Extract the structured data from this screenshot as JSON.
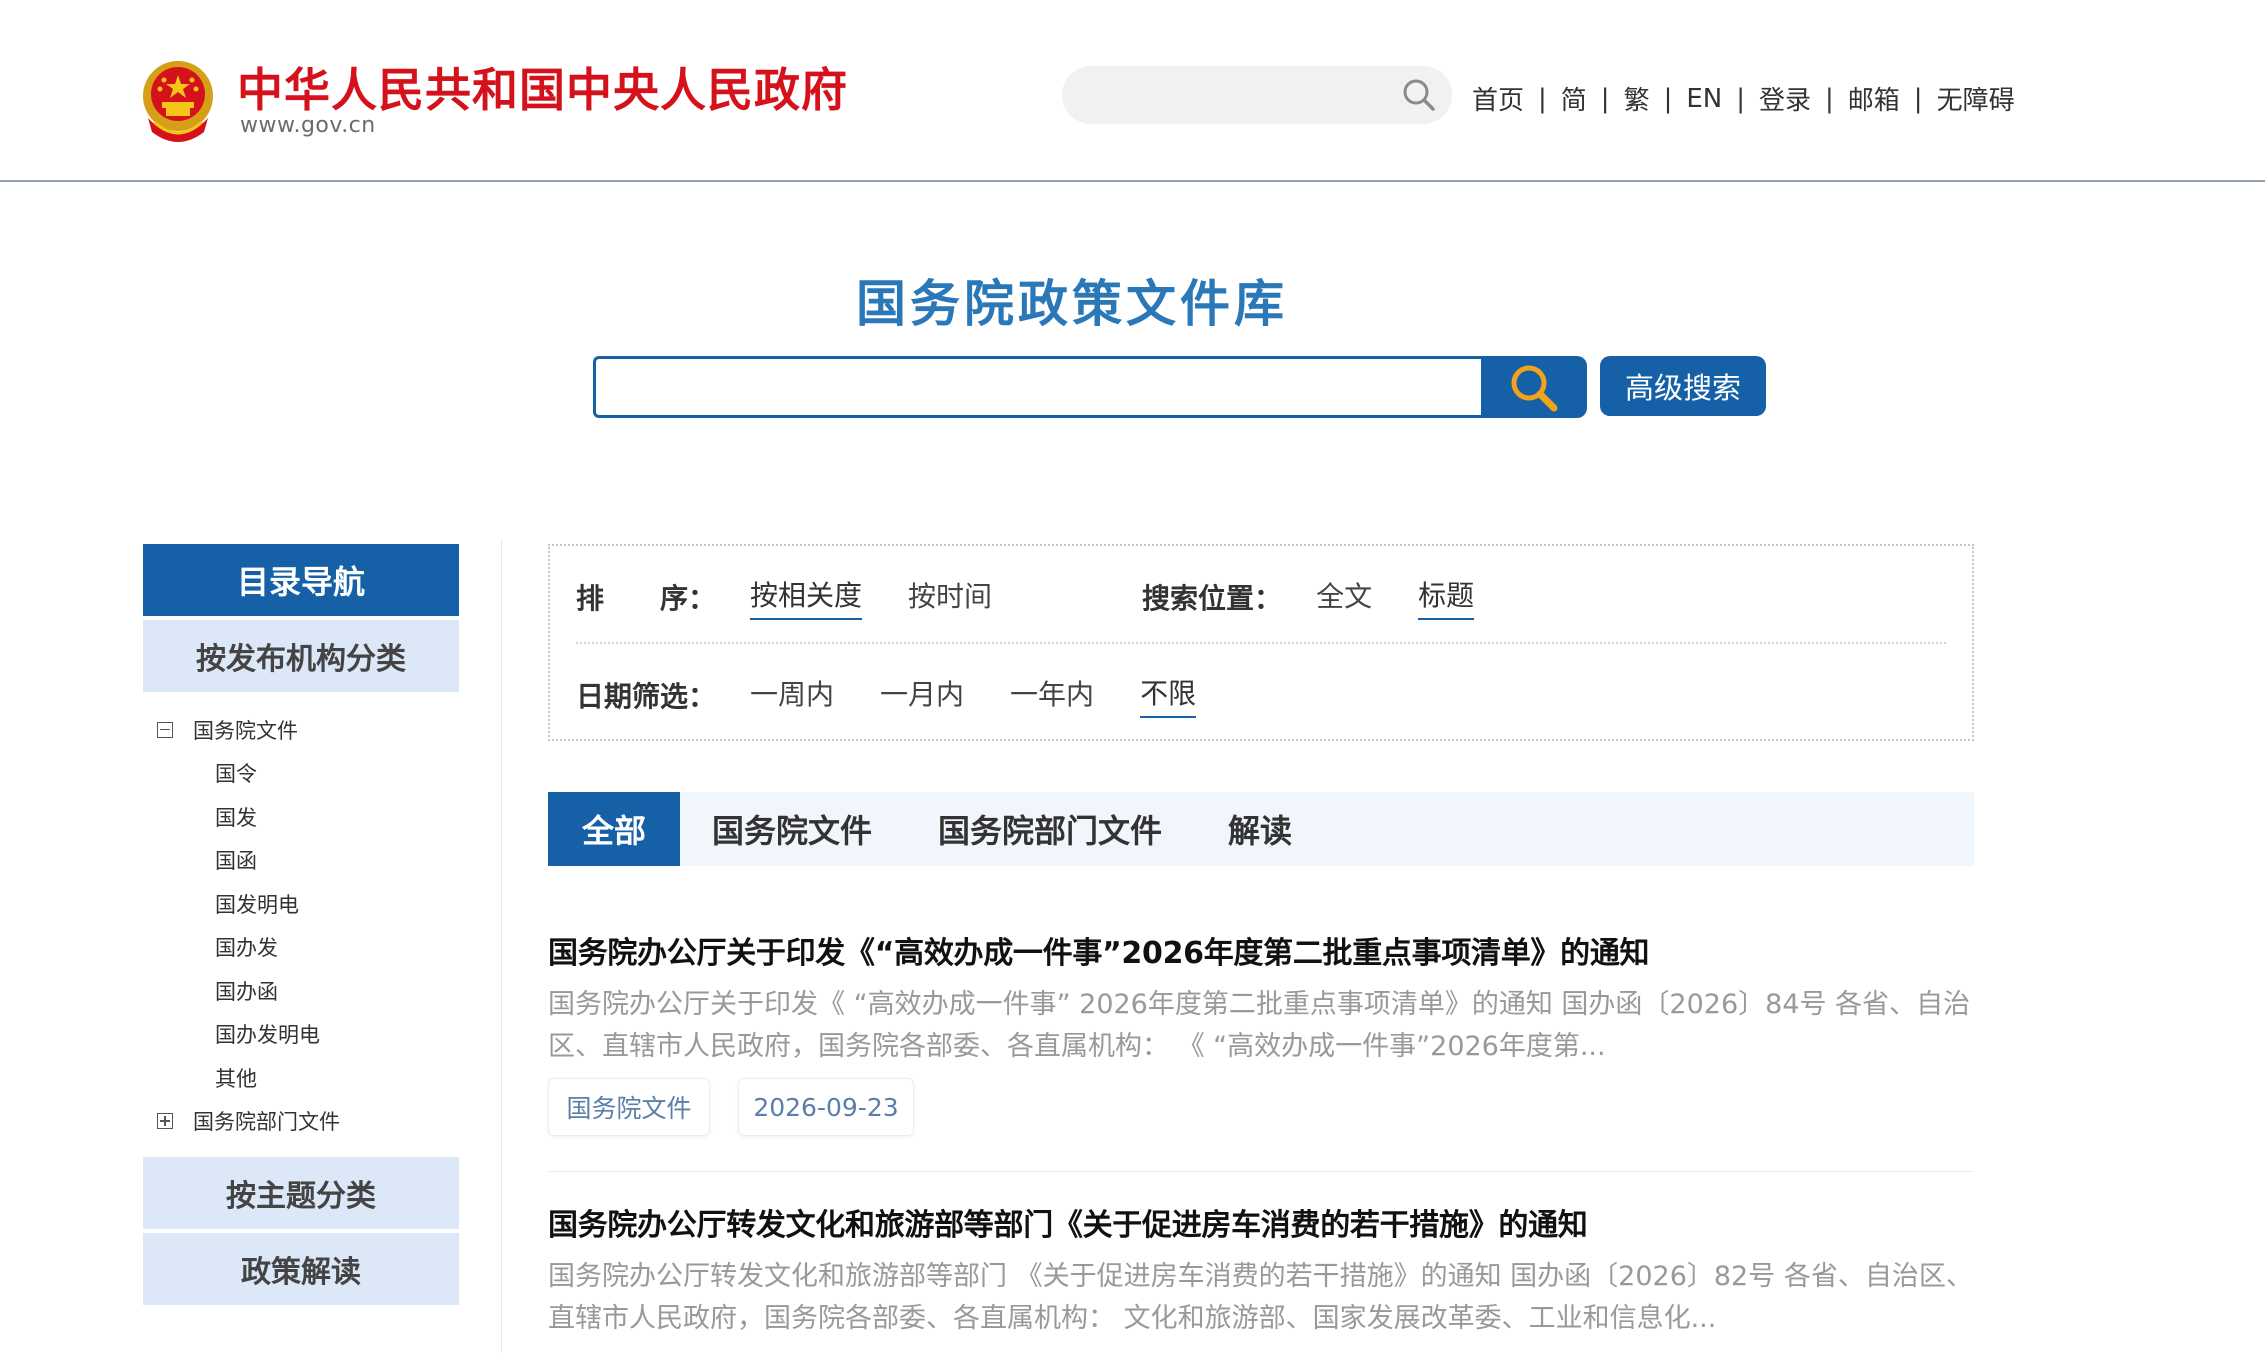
{
  "header": {
    "site_name": "中华人民共和国中央人民政府",
    "site_url": "www.gov.cn",
    "search_placeholder": "",
    "links": [
      "首页",
      "简",
      "繁",
      "EN",
      "登录",
      "邮箱",
      "无障碍"
    ]
  },
  "hero": {
    "title": "国务院政策文件库",
    "search_value": "",
    "advanced_label": "高级搜索"
  },
  "sidebar": {
    "nav_title": "目录导航",
    "by_org": "按发布机构分类",
    "tree": [
      {
        "label": "国务院文件",
        "expanded": true,
        "children": [
          "国令",
          "国发",
          "国函",
          "国发明电",
          "国办发",
          "国办函",
          "国办发明电",
          "其他"
        ]
      },
      {
        "label": "国务院部门文件",
        "expanded": false,
        "children": []
      }
    ],
    "by_topic": "按主题分类",
    "policy_interp": "政策解读"
  },
  "filters": {
    "sort_label": "排　　序：",
    "sort_options": [
      "按相关度",
      "按时间"
    ],
    "sort_active": "按相关度",
    "position_label": "搜索位置：",
    "position_options": [
      "全文",
      "标题"
    ],
    "position_active": "标题",
    "date_label": "日期筛选：",
    "date_options": [
      "一周内",
      "一月内",
      "一年内",
      "不限"
    ],
    "date_active": "不限"
  },
  "tabs": [
    "全部",
    "国务院文件",
    "国务院部门文件",
    "解读"
  ],
  "active_tab": "全部",
  "results": [
    {
      "title": "国务院办公厅关于印发《“高效办成一件事”2026年度第二批重点事项清单》的通知",
      "snippet_line1": "国务院办公厅关于印发《 “高效办成一件事” 2026年度第二批重点事项清单》的通知 国办函〔2026〕84号 各省、自治",
      "snippet_line2": "区、直辖市人民政府，国务院各部委、各直属机构： 《 “高效办成一件事”2026年度第...",
      "category": "国务院文件",
      "date": "2026-09-23"
    },
    {
      "title": "国务院办公厅转发文化和旅游部等部门《关于促进房车消费的若干措施》的通知",
      "snippet_line1": "国务院办公厅转发文化和旅游部等部门 《关于促进房车消费的若干措施》的通知 国办函〔2026〕82号 各省、自治区、",
      "snippet_line2": "直辖市人民政府，国务院各部委、各直属机构： 文化和旅游部、国家发展改革委、工业和信息化...",
      "category": "",
      "date": ""
    }
  ],
  "colors": {
    "brand_red": "#d5121b",
    "primary_blue": "#1660a8",
    "title_blue": "#2a78b8",
    "light_blue_bg": "#dce7f7",
    "tag_text": "#5a7fa8"
  },
  "icons": [
    "national-emblem-icon",
    "search-icon",
    "magnifier-icon",
    "minus-box-icon",
    "plus-box-icon"
  ]
}
